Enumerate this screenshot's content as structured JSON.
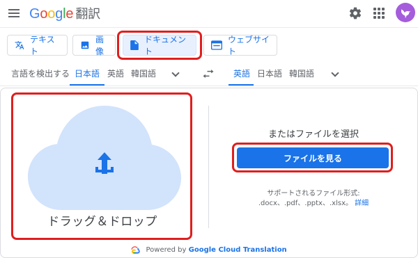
{
  "header": {
    "logo_letters": [
      "G",
      "o",
      "o",
      "g",
      "l",
      "e"
    ],
    "app_name": "翻訳",
    "icons": [
      "menu-icon",
      "gear-icon",
      "apps-grid-icon",
      "avatar"
    ]
  },
  "modes": [
    {
      "label": "テキスト",
      "icon": "translate-icon"
    },
    {
      "label": "画像",
      "icon": "image-icon"
    },
    {
      "label": "ドキュメント",
      "icon": "document-icon",
      "active": true
    },
    {
      "label": "ウェブサイト",
      "icon": "website-icon"
    }
  ],
  "source_langs": [
    "言語を検出する",
    "日本語",
    "英語",
    "韓国語"
  ],
  "source_selected": "日本語",
  "target_langs": [
    "英語",
    "日本語",
    "韓国語"
  ],
  "target_selected": "英語",
  "upload": {
    "drop_label": "ドラッグ＆ドロップ",
    "or_label": "またはファイルを選択",
    "browse_label": "ファイルを見る",
    "supported_label": "サポートされるファイル形式:",
    "supported_types": ".docx、.pdf、.pptx、.xlsx。",
    "details_link": "詳細"
  },
  "footer": {
    "powered_by": "Powered by",
    "brand": "Google Cloud Translation"
  },
  "colors": {
    "accent": "#1a73e8",
    "highlight_box": "#e01e1e",
    "cloud": "#d2e3fc"
  }
}
